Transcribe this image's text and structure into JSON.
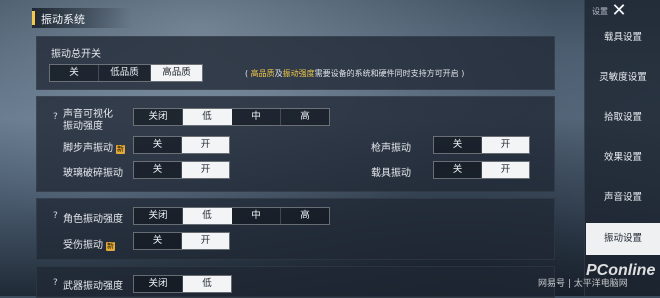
{
  "header": {
    "title": "振动系统"
  },
  "master": {
    "label": "振动总开关",
    "options": [
      "关",
      "低品质",
      "高品质"
    ],
    "selected": 2,
    "note_prefix": "( ",
    "note_hl1": "高品质",
    "note_mid1": "及",
    "note_hl2": "振动强度",
    "note_rest": "需要设备的系统和硬件同时支持方可开启 )"
  },
  "sound_visual": {
    "help": "?",
    "label_line1": "声音可视化",
    "label_line2": "振动强度",
    "options": [
      "关闭",
      "低",
      "中",
      "高"
    ],
    "selected": 1
  },
  "footstep": {
    "label": "脚步声振动",
    "badge": "新",
    "options": [
      "关",
      "开"
    ],
    "selected": 1
  },
  "gunshot": {
    "label": "枪声振动",
    "options": [
      "关",
      "开"
    ],
    "selected": 1
  },
  "glass": {
    "label": "玻璃破碎振动",
    "options": [
      "关",
      "开"
    ],
    "selected": 1
  },
  "vehicle": {
    "label": "载具振动",
    "options": [
      "关",
      "开"
    ],
    "selected": 1
  },
  "character": {
    "help": "?",
    "label": "角色振动强度",
    "options": [
      "关闭",
      "低",
      "中",
      "高"
    ],
    "selected": 1
  },
  "hurt": {
    "label": "受伤振动",
    "badge": "新",
    "options": [
      "关",
      "开"
    ],
    "selected": 1
  },
  "cutoff": {
    "help": "?",
    "label": "武器振动强度",
    "options": [
      "关闭",
      "低"
    ],
    "selected": 1
  },
  "sidebar": {
    "top_label": "设置",
    "close_icon": "close-icon",
    "items": [
      "载具设置",
      "灵敏度设置",
      "拾取设置",
      "效果设置",
      "声音设置",
      "振动设置"
    ],
    "active": 5
  },
  "watermark": {
    "brand": "PConline",
    "sub": "网易号 | 太平洋电脑网"
  },
  "colors": {
    "accent": "#f2c94c",
    "selected_bg": "#f3f4f5",
    "panel": "#202834"
  }
}
